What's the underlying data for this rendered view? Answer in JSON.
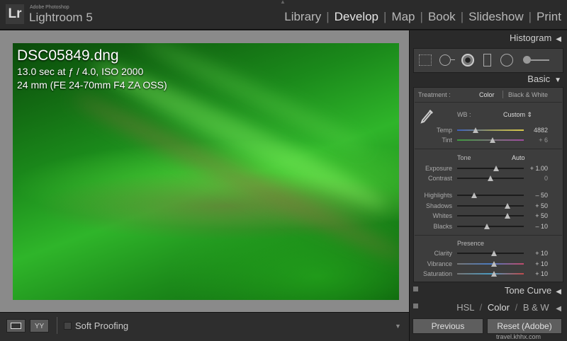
{
  "app": {
    "vendor": "Adobe Photoshop",
    "name": "Lightroom 5",
    "logo_text": "Lr"
  },
  "modules": [
    {
      "label": "Library"
    },
    {
      "label": "Develop",
      "active": true
    },
    {
      "label": "Map"
    },
    {
      "label": "Book"
    },
    {
      "label": "Slideshow"
    },
    {
      "label": "Print"
    }
  ],
  "photo_info": {
    "filename": "DSC05849.dng",
    "exposure_line": "13.0 sec at ƒ / 4.0, ISO 2000",
    "lens_line": "24 mm (FE 24-70mm F4 ZA OSS)"
  },
  "toolbar": {
    "yy_label": "YY",
    "soft_proofing_label": "Soft Proofing"
  },
  "panels": {
    "histogram": "Histogram",
    "basic": "Basic",
    "tone_curve": "Tone Curve",
    "hsl": {
      "hsl": "HSL",
      "color": "Color",
      "bw": "B & W",
      "sep": "/"
    }
  },
  "basic": {
    "treatment_label": "Treatment :",
    "treatment_color": "Color",
    "treatment_bw": "Black & White",
    "wb_label": "WB :",
    "wb_value": "Custom ⇕",
    "temp": {
      "label": "Temp",
      "value": "4882",
      "pos": 0.28
    },
    "tint": {
      "label": "Tint",
      "value": "+ 6",
      "pos": 0.53
    },
    "tone_label": "Tone",
    "auto_label": "Auto",
    "exposure": {
      "label": "Exposure",
      "value": "+ 1.00",
      "pos": 0.58
    },
    "contrast": {
      "label": "Contrast",
      "value": "0",
      "pos": 0.5
    },
    "highlights": {
      "label": "Highlights",
      "value": "– 50",
      "pos": 0.25
    },
    "shadows": {
      "label": "Shadows",
      "value": "+ 50",
      "pos": 0.75
    },
    "whites": {
      "label": "Whites",
      "value": "+ 50",
      "pos": 0.75
    },
    "blacks": {
      "label": "Blacks",
      "value": "– 10",
      "pos": 0.45
    },
    "presence_label": "Presence",
    "clarity": {
      "label": "Clarity",
      "value": "+ 10",
      "pos": 0.55
    },
    "vibrance": {
      "label": "Vibrance",
      "value": "+ 10",
      "pos": 0.55
    },
    "saturation": {
      "label": "Saturation",
      "value": "+ 10",
      "pos": 0.55
    }
  },
  "buttons": {
    "previous": "Previous",
    "reset": "Reset (Adobe)"
  },
  "watermark": "travel.khhx.com",
  "colors": {
    "photo_green": "#2fb52a",
    "panel_bg": "#3d3d3d",
    "active_module": "#e6e6e6"
  }
}
